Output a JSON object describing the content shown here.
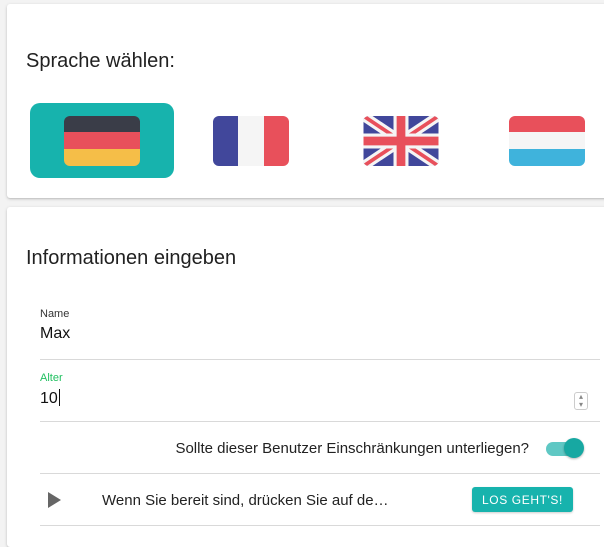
{
  "language_section": {
    "title": "Sprache wählen:",
    "languages": [
      {
        "code": "de",
        "flag": "germany-flag",
        "selected": true
      },
      {
        "code": "fr",
        "flag": "france-flag",
        "selected": false
      },
      {
        "code": "en",
        "flag": "uk-flag",
        "selected": false
      },
      {
        "code": "lu",
        "flag": "luxembourg-flag",
        "selected": false
      }
    ]
  },
  "info_section": {
    "title": "Informationen eingeben",
    "name": {
      "label": "Name",
      "value": "Max"
    },
    "age": {
      "label": "Alter",
      "value": "10"
    },
    "restrictions": {
      "label": "Sollte dieser Benutzer Einschränkungen unterliegen?",
      "enabled": true
    },
    "start": {
      "text": "Wenn Sie bereit sind, drücken Sie auf de…",
      "button_label": "LOS GEHT'S!"
    }
  },
  "colors": {
    "accent": "#17b3ad",
    "focus_label": "#20c060"
  }
}
